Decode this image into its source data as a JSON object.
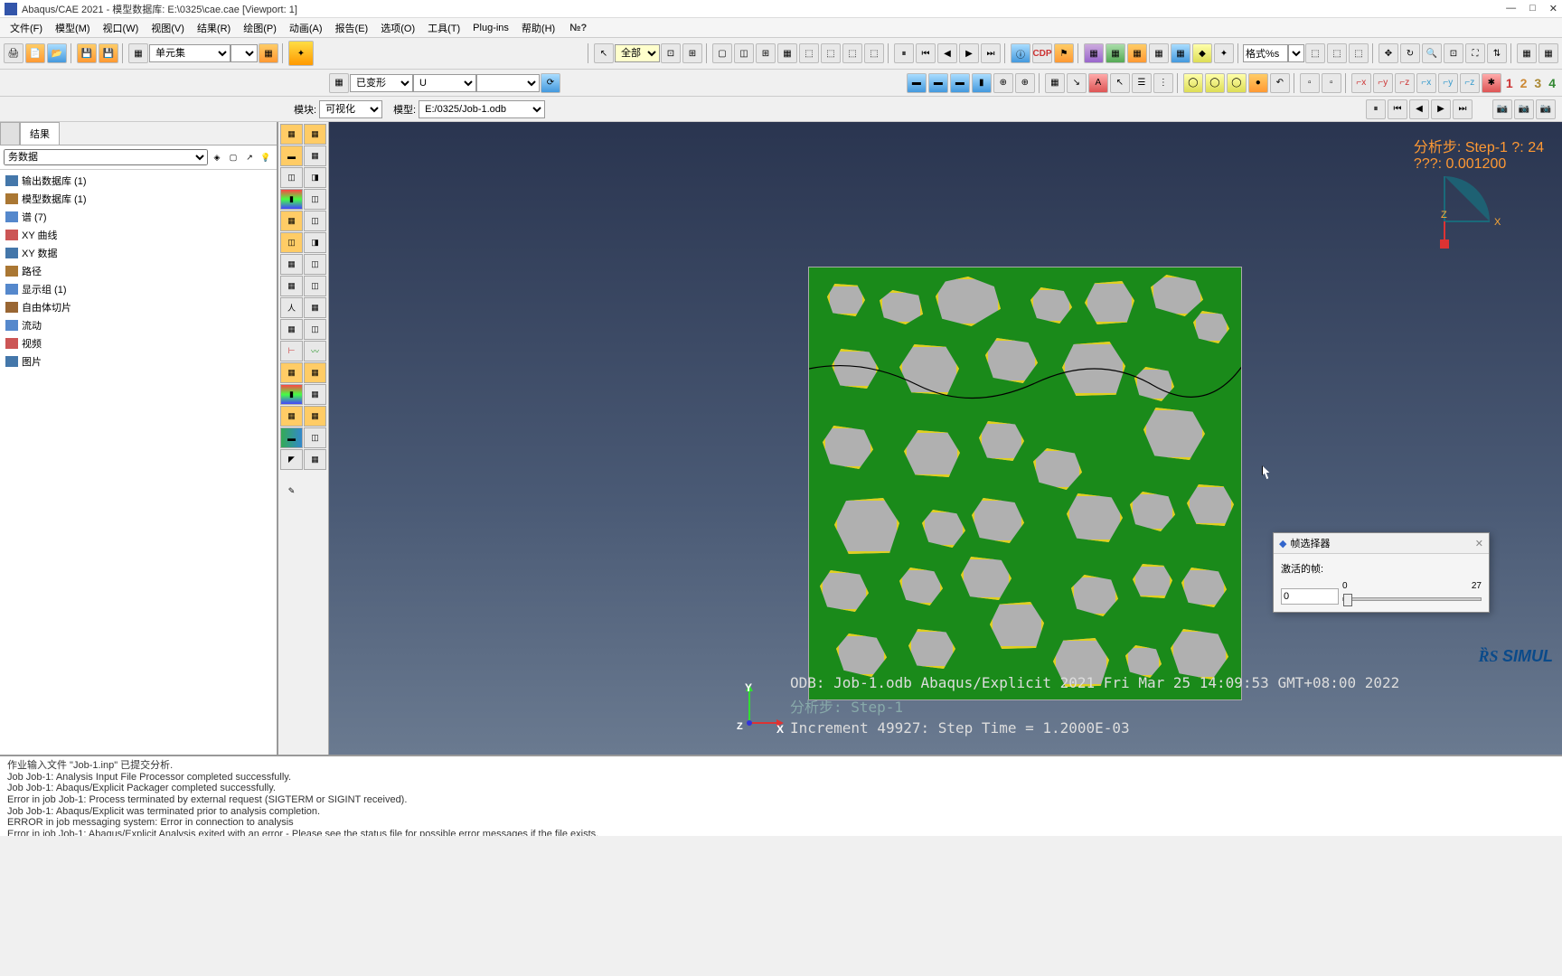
{
  "title": "Abaqus/CAE 2021 - 模型数据库: E:\\0325\\cae.cae [Viewport: 1]",
  "menu": [
    "文件(F)",
    "模型(M)",
    "视口(W)",
    "视图(V)",
    "结果(R)",
    "绘图(P)",
    "动画(A)",
    "报告(E)",
    "选项(O)",
    "工具(T)",
    "Plug-ins",
    "帮助(H)"
  ],
  "toolbar1": {
    "selector_all": "全部",
    "fmt": "格式%s"
  },
  "toolbar2": {
    "deform": "已变形",
    "field": "U"
  },
  "context": {
    "module_label": "模块:",
    "module_value": "可视化",
    "model_label": "模型:",
    "model_value": "E:/0325/Job-1.odb"
  },
  "tabs": {
    "results": "结果"
  },
  "tree_header": "务数据",
  "tree": [
    {
      "label": "输出数据库 (1)",
      "color": "#4477aa"
    },
    {
      "label": "模型数据库 (1)",
      "color": "#aa7733"
    },
    {
      "label": "谱 (7)",
      "color": "#5588cc"
    },
    {
      "label": "XY 曲线",
      "color": "#cc5555"
    },
    {
      "label": "XY 数据",
      "color": "#4477aa"
    },
    {
      "label": "路径",
      "color": "#aa7733"
    },
    {
      "label": "显示组 (1)",
      "color": "#5588cc"
    },
    {
      "label": "自由体切片",
      "color": "#996633"
    },
    {
      "label": "流动",
      "color": "#5588cc"
    },
    {
      "label": "视频",
      "color": "#cc5555"
    },
    {
      "label": "图片",
      "color": "#4477aa"
    }
  ],
  "viewport": {
    "odb_line": "ODB: Job-1.odb     Abaqus/Explicit 2021     Fri Mar 25 14:09:53 GMT+08:00 2022",
    "step_line": "分析步: Step-1",
    "inc_line": "Increment     49927: Step Time =   1.2000E-03",
    "status_step": "分析步: Step-1   ?: 24",
    "status_val": "???: 0.001200"
  },
  "frame_dialog": {
    "title": "帧选择器",
    "active_label": "激活的帧:",
    "min": "0",
    "max": "27",
    "value": "0"
  },
  "messages": [
    "作业输入文件 \"Job-1.inp\" 已提交分析.",
    "Job Job-1: Analysis Input File Processor completed successfully.",
    "Job Job-1: Abaqus/Explicit Packager completed successfully.",
    "Error in job Job-1: Process terminated by external request (SIGTERM or SIGINT received).",
    "Job Job-1: Abaqus/Explicit was terminated prior to analysis completion.",
    "ERROR in job messaging system: Error in connection to analysis",
    "Error in job Job-1: Abaqus/Explicit Analysis exited with an error - Please see the  status file for possible error messages if the file exists."
  ],
  "brand": "SIMUL",
  "axes": {
    "x": "X",
    "y": "Y",
    "z": "Z"
  },
  "nums": [
    "1",
    "2",
    "3",
    "4"
  ]
}
